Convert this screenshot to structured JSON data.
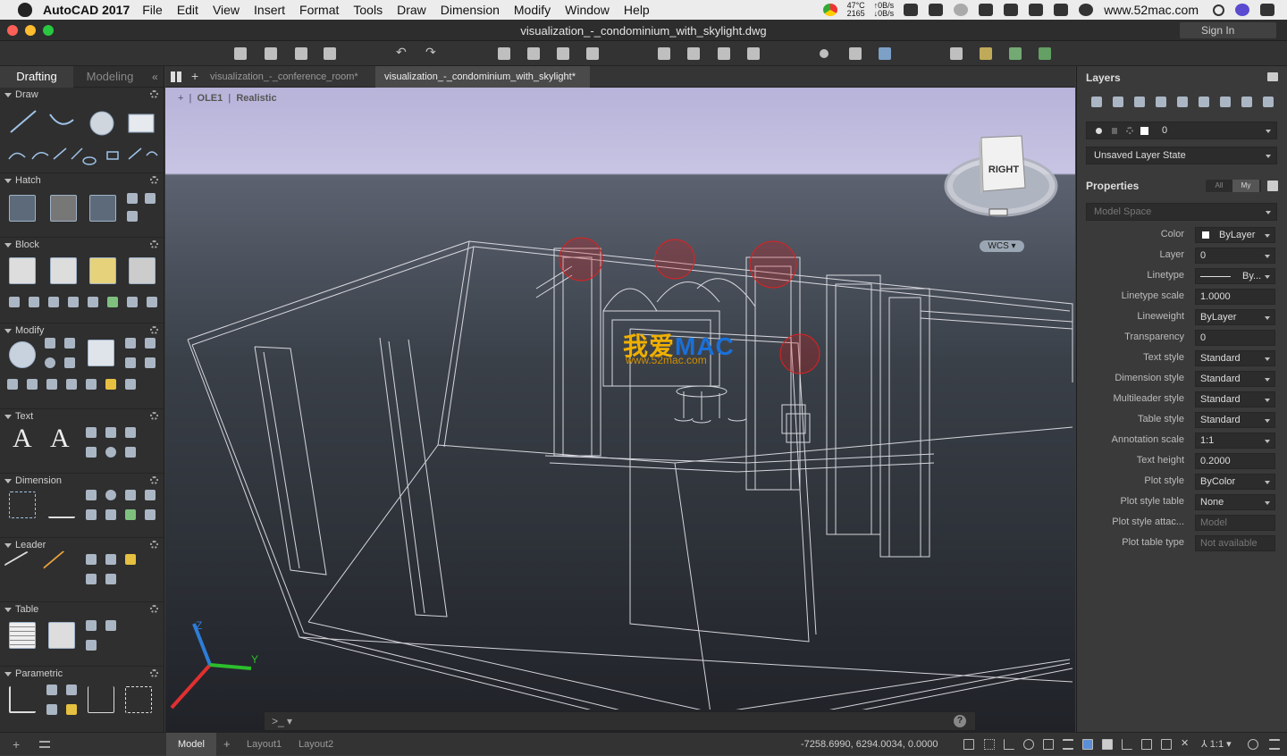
{
  "menubar": {
    "app": "AutoCAD 2017",
    "items": [
      "File",
      "Edit",
      "View",
      "Insert",
      "Format",
      "Tools",
      "Draw",
      "Dimension",
      "Modify",
      "Window",
      "Help"
    ],
    "temp": "47°C",
    "temp_sub": "2165",
    "net_up": "0B/s",
    "net_down": "0B/s",
    "host": "www.52mac.com"
  },
  "window": {
    "title": "visualization_-_condominium_with_skylight.dwg",
    "sign_in": "Sign In"
  },
  "left_panel": {
    "tabs": [
      "Drafting",
      "Modeling"
    ],
    "sections": [
      "Draw",
      "Hatch",
      "Block",
      "Modify",
      "Text",
      "Dimension",
      "Leader",
      "Table",
      "Parametric"
    ]
  },
  "file_tabs": [
    "visualization_-_conference_room*",
    "visualization_-_condominium_with_skylight*"
  ],
  "viewport": {
    "controls": "+",
    "view": "OLE1",
    "style": "Realistic",
    "navcube": "RIGHT",
    "wcs": "WCS",
    "watermark_main": "我爱",
    "watermark_mac": "MAC",
    "watermark_sub": "www.52mac.com",
    "axis_z": "Z",
    "axis_y": "Y"
  },
  "command": {
    "prompt": ">_",
    "help": "?"
  },
  "layers_panel": {
    "title": "Layers",
    "current_layer": "0",
    "layer_state": "Unsaved Layer State"
  },
  "properties_panel": {
    "title": "Properties",
    "toggle_all": "All",
    "toggle_my": "My",
    "context": "Model Space",
    "rows": [
      {
        "label": "Color",
        "value": "ByLayer",
        "dropdown": true,
        "disabled": false
      },
      {
        "label": "Layer",
        "value": "0",
        "dropdown": true,
        "disabled": false
      },
      {
        "label": "Linetype",
        "value": "By...",
        "dropdown": true,
        "disabled": false
      },
      {
        "label": "Linetype scale",
        "value": "1.0000",
        "dropdown": false,
        "disabled": false
      },
      {
        "label": "Lineweight",
        "value": "ByLayer",
        "dropdown": true,
        "disabled": false
      },
      {
        "label": "Transparency",
        "value": "0",
        "dropdown": false,
        "disabled": false
      },
      {
        "label": "Text style",
        "value": "Standard",
        "dropdown": true,
        "disabled": false
      },
      {
        "label": "Dimension style",
        "value": "Standard",
        "dropdown": true,
        "disabled": false
      },
      {
        "label": "Multileader style",
        "value": "Standard",
        "dropdown": true,
        "disabled": false
      },
      {
        "label": "Table style",
        "value": "Standard",
        "dropdown": true,
        "disabled": false
      },
      {
        "label": "Annotation scale",
        "value": "1:1",
        "dropdown": true,
        "disabled": false
      },
      {
        "label": "Text height",
        "value": "0.2000",
        "dropdown": false,
        "disabled": false
      },
      {
        "label": "Plot style",
        "value": "ByColor",
        "dropdown": true,
        "disabled": false
      },
      {
        "label": "Plot style table",
        "value": "None",
        "dropdown": true,
        "disabled": false
      },
      {
        "label": "Plot style attac...",
        "value": "Model",
        "dropdown": false,
        "disabled": true
      },
      {
        "label": "Plot table type",
        "value": "Not available",
        "dropdown": false,
        "disabled": true
      }
    ]
  },
  "statusbar": {
    "tabs": [
      "Model",
      "Layout1",
      "Layout2"
    ],
    "coords": "-7258.6990, 6294.0034, 0.0000",
    "scale": "1:1"
  }
}
